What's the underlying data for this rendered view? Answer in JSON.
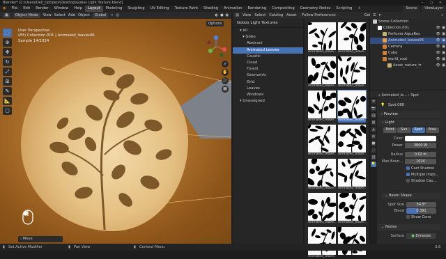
{
  "window": {
    "title": "Blender* [C:\\Users\\Dell_Optiplex\\Desktop\\Gobos Light Texture.blend]"
  },
  "menubar": {
    "items": [
      "File",
      "Edit",
      "Render",
      "Window",
      "Help"
    ],
    "workspaces": [
      "Layout",
      "Modeling",
      "Sculpting",
      "UV Editing",
      "Texture Paint",
      "Shading",
      "Animation",
      "Rendering",
      "Compositing",
      "Geometry Nodes",
      "Scripting"
    ],
    "add_tab": "+",
    "scene": "Scene",
    "view_layer": "ViewLayer"
  },
  "viewport": {
    "mode": "Object Mode",
    "menu": [
      "View",
      "Select",
      "Add",
      "Object"
    ],
    "orientation": "Global",
    "options": "Options",
    "info_lines": [
      "User Perspective",
      "(83) Collection.001 | Animated_leaves06",
      "Sample 14/1024"
    ],
    "last_op": "Move"
  },
  "filebrowser": {
    "menu": [
      "View",
      "Select",
      "Catalog",
      "Asset"
    ],
    "prefs_button": "Follow Preferences",
    "library_title": "Gobos Light Textures",
    "library_field": "Gobos Light T...",
    "tree": [
      {
        "label": "All",
        "level": 0,
        "selected": false
      },
      {
        "label": "Gobo",
        "level": 1,
        "selected": false
      },
      {
        "label": "Abstract",
        "level": 2,
        "selected": false
      },
      {
        "label": "Animated Leaves",
        "level": 2,
        "selected": true
      },
      {
        "label": "Caustic",
        "level": 2,
        "selected": false
      },
      {
        "label": "Cloud",
        "level": 2,
        "selected": false
      },
      {
        "label": "Forest",
        "level": 2,
        "selected": false
      },
      {
        "label": "Geometric",
        "level": 2,
        "selected": false
      },
      {
        "label": "Grid",
        "level": 2,
        "selected": false
      },
      {
        "label": "Leaves",
        "level": 2,
        "selected": false
      },
      {
        "label": "Windows",
        "level": 2,
        "selected": false
      },
      {
        "label": "Unassigned",
        "level": 0,
        "selected": false
      }
    ],
    "thumbs": [
      {
        "label": "Animated_leave...",
        "selected": false
      },
      {
        "label": "Animated_leave...",
        "selected": false
      },
      {
        "label": "Animated_leave...",
        "selected": false
      },
      {
        "label": "Animated_leave...",
        "selected": false
      },
      {
        "label": "Animated_leave...",
        "selected": false
      },
      {
        "label": "Animated_leave...",
        "selected": true
      },
      {
        "label": "Animated_leave...",
        "selected": false
      },
      {
        "label": "Animated_leave...",
        "selected": false
      },
      {
        "label": "Animated_leave...",
        "selected": false
      },
      {
        "label": "Animated_leave...",
        "selected": false
      },
      {
        "label": "Animated_leave...",
        "selected": false
      },
      {
        "label": "Animated_leave...",
        "selected": false
      },
      {
        "label": "Animated_leave...",
        "selected": false
      },
      {
        "label": "",
        "selected": false
      }
    ]
  },
  "outliner": {
    "rows": [
      {
        "label": "Scene Collection",
        "indent": 0,
        "color": "#cccccc",
        "selected": false
      },
      {
        "label": "Collection.001",
        "indent": 1,
        "color": "#ffffff",
        "selected": false
      },
      {
        "label": "Perfume AquaRes",
        "indent": 2,
        "color": "#c8b070",
        "selected": false
      },
      {
        "label": "Animated_leaves06",
        "indent": 2,
        "color": "#e8a040",
        "selected": true
      },
      {
        "label": "Camera",
        "indent": 2,
        "color": "#d08030",
        "selected": false
      },
      {
        "label": "Cube",
        "indent": 2,
        "color": "#d08030",
        "selected": false
      },
      {
        "label": "world_root",
        "indent": 2,
        "color": "#d08030",
        "selected": false
      },
      {
        "label": "Asset_nature_tr",
        "indent": 3,
        "color": "#c8b070",
        "selected": false
      }
    ]
  },
  "properties": {
    "header_obj": "Animated_le...",
    "header_data": "Spot",
    "datablock": "Spot.088",
    "sections": {
      "preview": "Preview",
      "light": "Light",
      "beam": "Beam Shape",
      "nodes": "Nodes"
    },
    "light_types": [
      "Point",
      "Sun",
      "Spot",
      "Area"
    ],
    "light_type_active": "Spot",
    "fields": {
      "color_label": "Color",
      "power_label": "Power",
      "power": "3000 W",
      "radius_label": "Radius",
      "radius": "0.02 m",
      "max_bounces_label": "Max Boun...",
      "max_bounces": "1024",
      "cast_shadow": "Cast Shadow",
      "multiple_importance": "Multiple Impo...",
      "shadow_caustics": "Shadow Cau...",
      "spot_size_label": "Spot Size",
      "spot_size": "54.5°",
      "blend_label": "Blend",
      "blend": "0.391",
      "show_cone": "Show Cone",
      "surface_label": "Surface",
      "surface": "Emission"
    }
  },
  "statusbar": {
    "left": "Set Active Modifier",
    "mid": "Pan View",
    "right": "Context Menu",
    "version": "3.6"
  },
  "colors": {
    "accent": "#4772b3",
    "brand": "#e87d0d"
  }
}
